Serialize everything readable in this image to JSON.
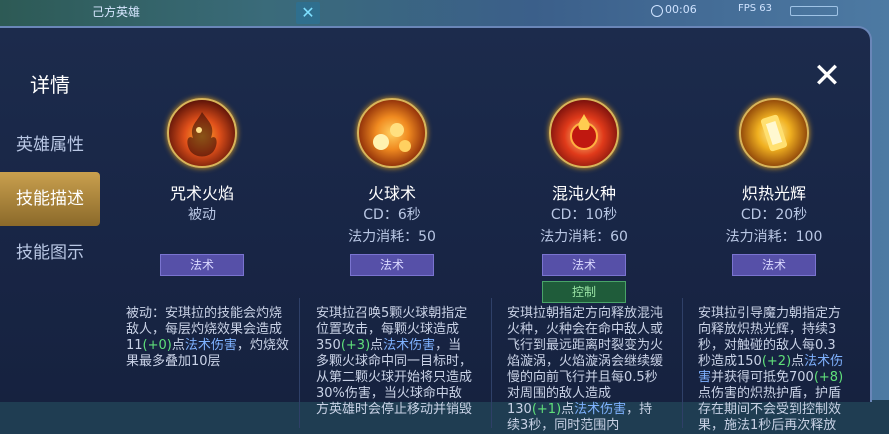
{
  "top": {
    "hero_tag": "己方英雄",
    "time": "00:06",
    "fps": "FPS 63"
  },
  "panel": {
    "title": "详情",
    "close_glyph": "✕"
  },
  "sidebar": {
    "items": [
      {
        "label": "英雄属性"
      },
      {
        "label": "技能描述"
      },
      {
        "label": "技能图示"
      }
    ],
    "active_index": 1
  },
  "skills": [
    {
      "name": "咒术火焰",
      "cd": "被动",
      "cost": "",
      "tag": "法术",
      "extra_tag": "",
      "icon": "fire-spirit-icon"
    },
    {
      "name": "火球术",
      "cd": "CD：6秒",
      "cost": "法力消耗：50",
      "tag": "法术",
      "extra_tag": "",
      "icon": "fireballs-icon"
    },
    {
      "name": "混沌火种",
      "cd": "CD：10秒",
      "cost": "法力消耗：60",
      "tag": "法术",
      "extra_tag": "控制",
      "icon": "chaos-flame-orb-icon"
    },
    {
      "name": "炽热光辉",
      "cd": "CD：20秒",
      "cost": "法力消耗：100",
      "tag": "法术",
      "extra_tag": "",
      "icon": "blazing-beam-icon"
    }
  ],
  "descriptions": [
    {
      "parts": [
        "被动：安琪拉的技能会灼烧敌人，每层灼烧效果会造成11",
        "(+0)",
        "点",
        "法术伤害",
        "，灼烧效果最多叠加10层"
      ]
    },
    {
      "parts": [
        "安琪拉召唤5颗火球朝指定位置攻击，每颗火球造成350",
        "(+3)",
        "点",
        "法术伤害",
        "，当多颗火球命中同一目标时，从第二颗火球开始将只造成30%伤害，当火球命中敌方英雄时会停止移动并销毁"
      ]
    },
    {
      "parts": [
        "安琪拉朝指定方向释放混沌火种，火种会在命中敌人或飞行到最远距离时裂变为火焰漩涡，火焰漩涡会继续缓慢的向前飞行并且每0.5秒对周围的敌人造成130",
        "(+1)",
        "点",
        "法术伤害",
        "，持续3秒，同时范围内"
      ]
    },
    {
      "parts": [
        "安琪拉引导魔力朝指定方向释放炽热光辉，持续3秒，对触碰的敌人每0.3秒造成150",
        "(+2)",
        "点",
        "法术伤害",
        "并获得可抵免700",
        "(+8)",
        "点伤害的炽热护盾，护盾存在期间不会受到控制效果，施法1秒后再次释放"
      ]
    }
  ],
  "colors": {
    "accent_gold": "#c9a04e",
    "link_blue": "#7fb2ff",
    "bonus_green": "#5fe07a"
  }
}
